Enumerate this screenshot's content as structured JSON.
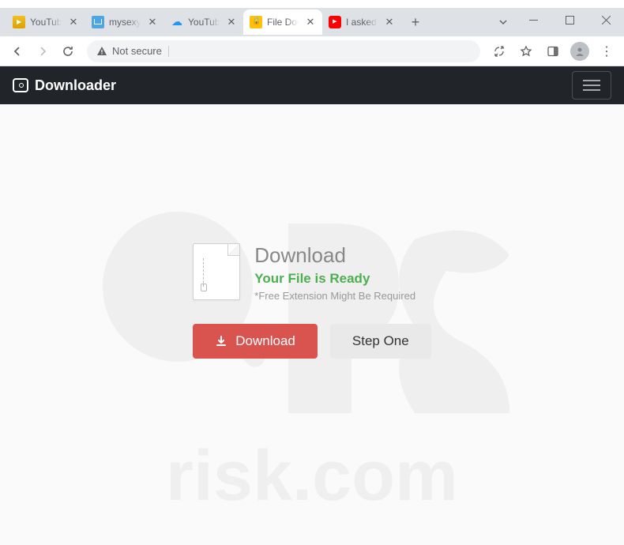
{
  "browser": {
    "tabs": [
      {
        "title": "YouTube",
        "favicon": "fav-yt-old",
        "active": false
      },
      {
        "title": "mysexymandy",
        "favicon": "fav-blue",
        "active": false
      },
      {
        "title": "YouTube",
        "favicon": "fav-cloud",
        "active": false
      },
      {
        "title": "File Download",
        "favicon": "fav-lock",
        "active": true
      },
      {
        "title": "I asked an AI",
        "favicon": "fav-yt",
        "active": false
      }
    ],
    "address": {
      "security_label": "Not secure",
      "url": ""
    }
  },
  "page": {
    "brand": "Downloader",
    "download": {
      "heading": "Download",
      "ready": "Your File is Ready",
      "note": "*Free Extension Might Be Required",
      "button_download": "Download",
      "button_step": "Step One"
    }
  },
  "watermark": {
    "text": "risk.com"
  }
}
